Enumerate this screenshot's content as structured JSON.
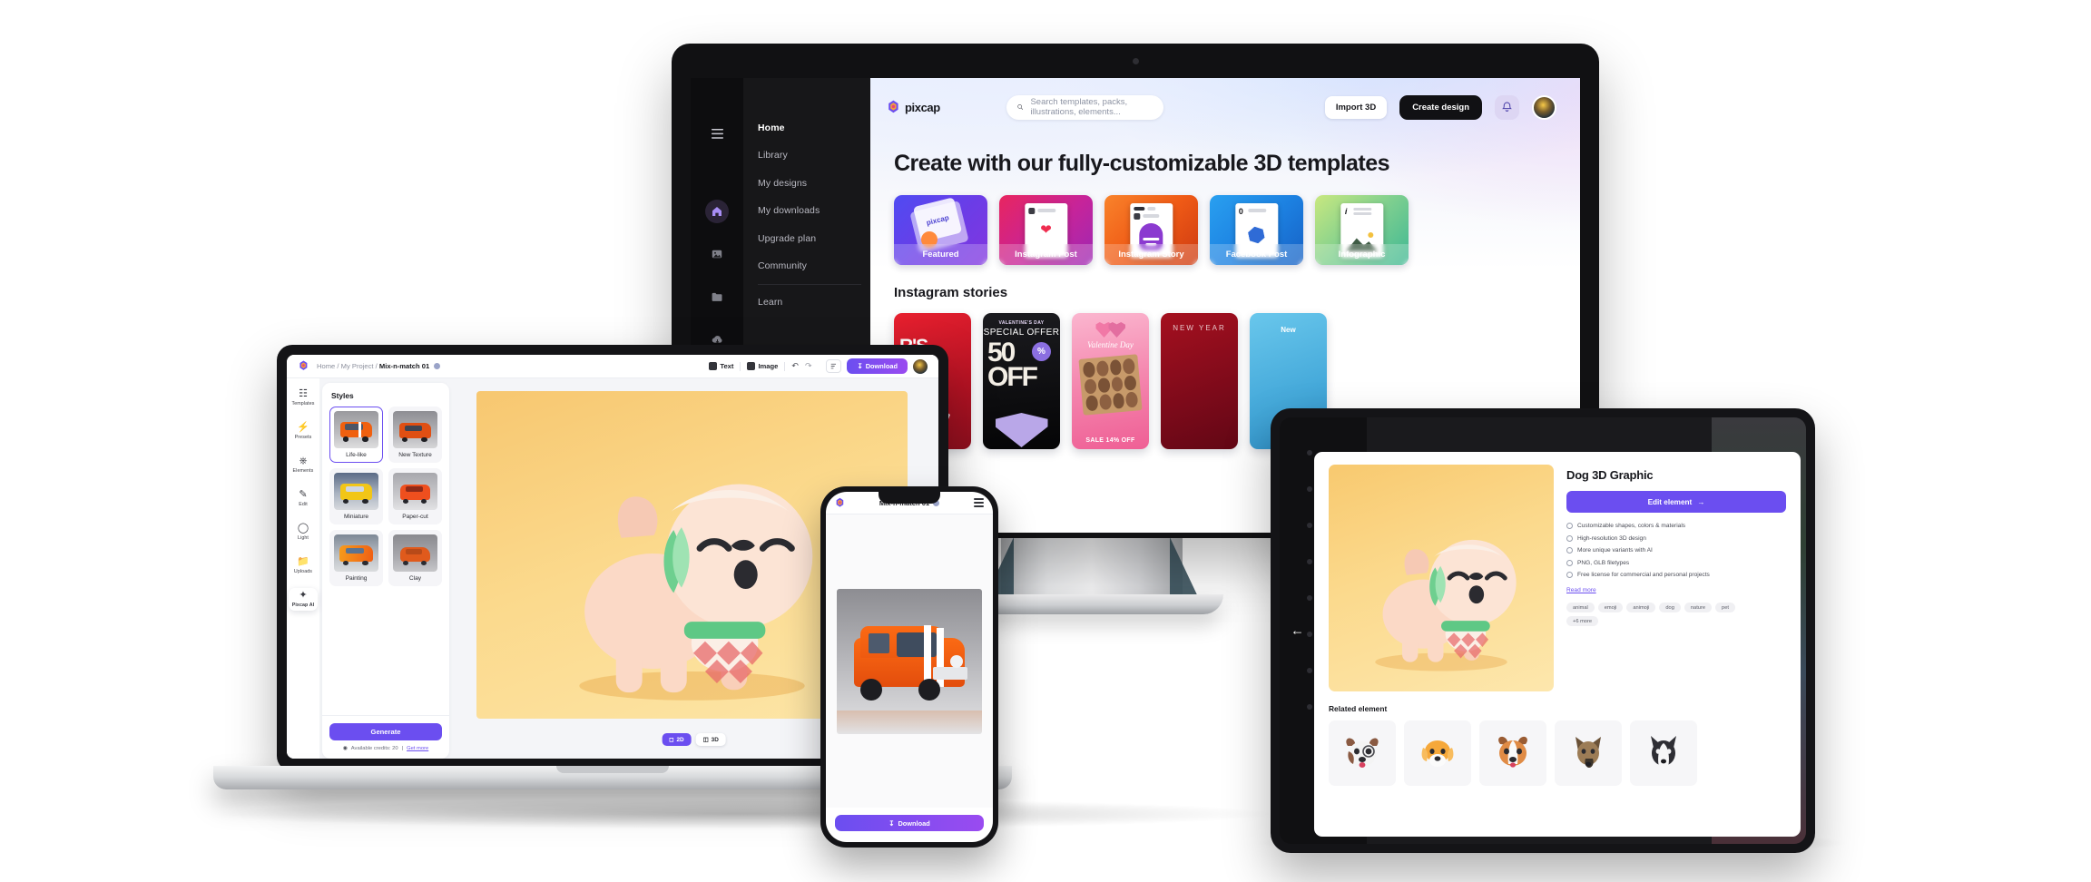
{
  "desktop": {
    "brand": "pixcap",
    "search": {
      "placeholder": "Search templates, packs, illustrations, elements...",
      "icon": "search-icon"
    },
    "buttons": {
      "import": "Import 3D",
      "create": "Create design",
      "bell_icon": "bell-icon",
      "menu_icon": "hamburger-icon"
    },
    "nav": [
      {
        "label": "Home",
        "icon": "home-icon",
        "active": true
      },
      {
        "label": "Library",
        "icon": "image-icon",
        "active": false
      },
      {
        "label": "My designs",
        "icon": "folder-icon",
        "active": false
      },
      {
        "label": "My downloads",
        "icon": "cloud-download-icon",
        "active": false
      },
      {
        "label": "Upgrade plan",
        "icon": "crown-icon",
        "active": false
      },
      {
        "label": "Community",
        "icon": "globe-icon",
        "active": false
      },
      {
        "label": "Learn",
        "icon": "book-icon",
        "active": false
      }
    ],
    "heading": "Create with our fully-customizable 3D templates",
    "cards": [
      {
        "label": "Featured",
        "color_a": "#4f4bf2",
        "color_b": "#7b3ce8"
      },
      {
        "label": "Instagram Post",
        "color_a": "#e8255f",
        "color_b": "#a7269f"
      },
      {
        "label": "Instagram Story",
        "color_a": "#f56a0f",
        "color_b": "#d13c16"
      },
      {
        "label": "Facebook Post",
        "color_a": "#1e87e8",
        "color_b": "#1565c9"
      },
      {
        "label": "Infographic",
        "color_a": "#b9e27a",
        "color_b": "#45b98a"
      }
    ],
    "section_title": "Instagram stories",
    "stories": [
      {
        "label": "R'S\nION",
        "color_a": "#e11b2e",
        "color_b": "#8d0f1e"
      },
      {
        "label": "50% OFF",
        "sup": "VALENTINE'S DAY",
        "sub": "SPECIAL OFFER",
        "color_a": "#17171a",
        "color_b": "#000000"
      },
      {
        "label": "Valentine Day",
        "sub": "SALE 14% OFF",
        "color_a": "#f8a0c0",
        "color_b": "#ef5f95"
      },
      {
        "label": "NEW YEAR",
        "color_a": "#8e0b20",
        "color_b": "#6a0718"
      },
      {
        "label": "New",
        "color_a": "#54bbe6",
        "color_b": "#2e9ad0"
      }
    ]
  },
  "laptop": {
    "breadcrumb": {
      "home": "Home",
      "sep": "/",
      "project": "My Project",
      "file": "Mix-n-match 01"
    },
    "toolbar": {
      "text": "Text",
      "image": "Image",
      "undo_icon": "undo-icon",
      "redo_icon": "redo-icon",
      "layers_icon": "layers-icon",
      "download": "Download",
      "avatar": "user-avatar"
    },
    "rail": [
      {
        "label": "Templates",
        "icon": "templates-icon",
        "active": false
      },
      {
        "label": "Presets",
        "icon": "bolt-icon",
        "active": false
      },
      {
        "label": "Elements",
        "icon": "puzzle-icon",
        "active": false
      },
      {
        "label": "Edit",
        "icon": "pencil-icon",
        "active": false
      },
      {
        "label": "Light",
        "icon": "bulb-icon",
        "active": false
      },
      {
        "label": "Uploads",
        "icon": "upload-icon",
        "active": false
      },
      {
        "label": "Pixcap AI",
        "icon": "sparkle-icon",
        "active": true
      }
    ],
    "panel": {
      "title": "Styles",
      "styles": [
        {
          "name": "Life-like",
          "selected": true
        },
        {
          "name": "New Texture",
          "selected": false
        },
        {
          "name": "Miniature",
          "selected": false
        },
        {
          "name": "Paper-cut",
          "selected": false
        },
        {
          "name": "Painting",
          "selected": false
        },
        {
          "name": "Clay",
          "selected": false
        }
      ],
      "generate": "Generate",
      "credits_label": "Available credits: 20",
      "credits_link": "Get more"
    },
    "view": {
      "two_d": "2D",
      "three_d": "3D",
      "active": "2D"
    }
  },
  "phone": {
    "title": "Mix-n-match 01",
    "menu_icon": "hamburger-icon",
    "logo_icon": "pixcap-logo-icon",
    "download": "Download"
  },
  "tablet": {
    "title": "Dog 3D Graphic",
    "cta": "Edit element",
    "cta_arrow": "→",
    "features": [
      "Customizable shapes, colors & materials",
      "High-resolution 3D design",
      "More unique variants with AI",
      "PNG, GLB filetypes",
      "Free license for commercial and personal projects"
    ],
    "read_more": "Read more",
    "tags": [
      "animal",
      "emoji",
      "animoji",
      "dog",
      "nature",
      "pet",
      "+6 more"
    ],
    "related_title": "Related element",
    "related": [
      {
        "name": "puppy-beagle-spotted"
      },
      {
        "name": "puppy-golden"
      },
      {
        "name": "puppy-jack-russell"
      },
      {
        "name": "german-shepherd"
      },
      {
        "name": "husky"
      }
    ],
    "nav": {
      "prev_icon": "arrow-left-icon",
      "next_icon": "arrow-right-icon"
    }
  },
  "theme": {
    "accent": "#6b4ef0",
    "accent_grad_end": "#9a4bf0",
    "dark": "#141417",
    "text": "#17181d"
  }
}
